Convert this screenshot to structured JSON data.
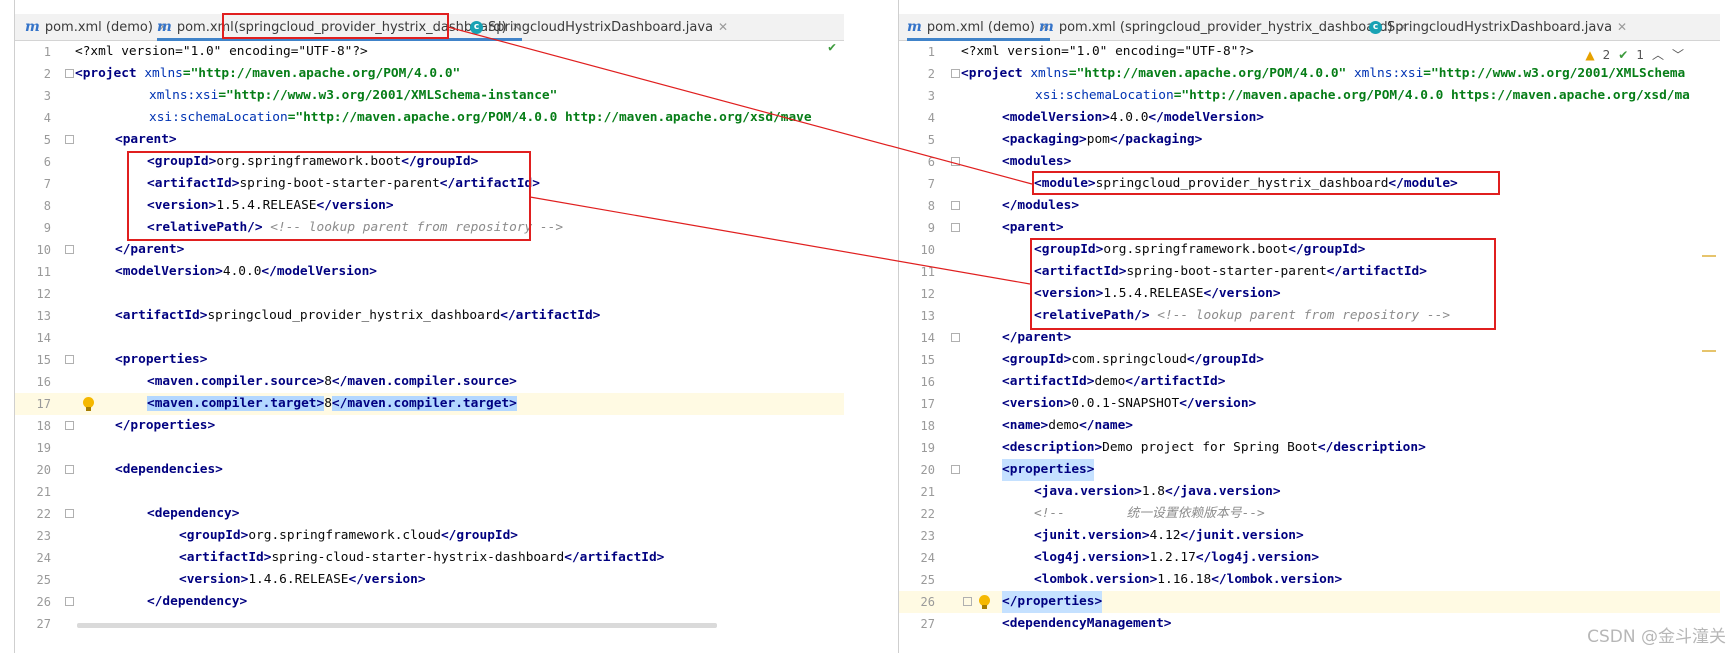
{
  "left_editor": {
    "tabs": [
      {
        "label": "pom.xml (demo)",
        "icon": "maven-icon"
      },
      {
        "label_prefix": "pom.xml ",
        "label_highlight": "(springcloud_provider_hystrix_dashboard)",
        "icon": "maven-icon"
      },
      {
        "label": "SpringcloudHystrixDashboard.java",
        "icon": "java-class-icon"
      }
    ],
    "line_numbers": [
      "1",
      "2",
      "3",
      "4",
      "5",
      "6",
      "7",
      "8",
      "9",
      "10",
      "11",
      "12",
      "13",
      "14",
      "15",
      "16",
      "17",
      "18",
      "19",
      "20",
      "21",
      "22",
      "23",
      "24",
      "25",
      "26",
      "27"
    ],
    "lines": {
      "l1": "<?xml version=\"1.0\" encoding=\"UTF-8\"?>",
      "l2_tag": "<project ",
      "l2_attr": "xmlns",
      "l2_val": "=\"http://maven.apache.org/POM/4.0.0\"",
      "l3_attr": "xmlns:xsi",
      "l3_val": "=\"http://www.w3.org/2001/XMLSchema-instance\"",
      "l4_attr": "xsi:schemaLocation",
      "l4_val": "=\"http://maven.apache.org/POM/4.0.0 http://maven.apache.org/xsd/mave",
      "l5": "<parent>",
      "l6_open": "<groupId>",
      "l6_text": "org.springframework.boot",
      "l6_close": "</groupId>",
      "l7_open": "<artifactId>",
      "l7_text": "spring-boot-starter-parent",
      "l7_close": "</artifactId>",
      "l8_open": "<version>",
      "l8_text": "1.5.4.RELEASE",
      "l8_close": "</version>",
      "l9_open": "<relativePath/>",
      "l9_comment": " <!-- lookup parent from repository -->",
      "l10": "</parent>",
      "l11_open": "<modelVersion>",
      "l11_text": "4.0.0",
      "l11_close": "</modelVersion>",
      "l13_open": "<artifactId>",
      "l13_text": "springcloud_provider_hystrix_dashboard",
      "l13_close": "</artifactId>",
      "l15": "<properties>",
      "l16_open": "<maven.compiler.source>",
      "l16_text": "8",
      "l16_close": "</maven.compiler.source>",
      "l17_open": "<maven.compiler.target>",
      "l17_text": "8",
      "l17_close": "</maven.compiler.target>",
      "l18": "</properties>",
      "l20": "<dependencies>",
      "l22": "<dependency>",
      "l23_open": "<groupId>",
      "l23_text": "org.springframework.cloud",
      "l23_close": "</groupId>",
      "l24_open": "<artifactId>",
      "l24_text": "spring-cloud-starter-hystrix-dashboard",
      "l24_close": "</artifactId>",
      "l25_open": "<version>",
      "l25_text": "1.4.6.RELEASE",
      "l25_close": "</version>",
      "l26": "</dependency>"
    }
  },
  "right_editor": {
    "tabs": [
      {
        "label": "pom.xml (demo)",
        "icon": "maven-icon"
      },
      {
        "label": "pom.xml (springcloud_provider_hystrix_dashboard)",
        "icon": "maven-icon"
      },
      {
        "label": "SpringcloudHystrixDashboard.java",
        "icon": "java-class-icon"
      }
    ],
    "inspection": {
      "warnings": "2",
      "weak_warnings": "1"
    },
    "line_numbers": [
      "1",
      "2",
      "3",
      "4",
      "5",
      "6",
      "7",
      "8",
      "9",
      "10",
      "11",
      "12",
      "13",
      "14",
      "15",
      "16",
      "17",
      "18",
      "19",
      "20",
      "21",
      "22",
      "23",
      "24",
      "25",
      "26",
      "27"
    ],
    "lines": {
      "l1": "<?xml version=\"1.0\" encoding=\"UTF-8\"?>",
      "l2_tag": "<project ",
      "l2_attr": "xmlns",
      "l2_val": "=\"http://maven.apache.org/POM/4.0.0\" ",
      "l2_attr2": "xmlns:xsi",
      "l2_val2": "=\"http://www.w3.org/2001/XMLSchema",
      "l3_attr": "xsi:schemaLocation",
      "l3_val": "=\"http://maven.apache.org/POM/4.0.0 https://maven.apache.org/xsd/ma",
      "l4_open": "<modelVersion>",
      "l4_text": "4.0.0",
      "l4_close": "</modelVersion>",
      "l5_open": "<packaging>",
      "l5_text": "pom",
      "l5_close": "</packaging>",
      "l6": "<modules>",
      "l7_open": "<module>",
      "l7_text": "springcloud_provider_hystrix_dashboard",
      "l7_close": "</module>",
      "l8": "</modules>",
      "l9": "<parent>",
      "l10_open": "<groupId>",
      "l10_text": "org.springframework.boot",
      "l10_close": "</groupId>",
      "l11_open": "<artifactId>",
      "l11_text": "spring-boot-starter-parent",
      "l11_close": "</artifactId>",
      "l12_open": "<version>",
      "l12_text": "1.5.4.RELEASE",
      "l12_close": "</version>",
      "l13_open": "<relativePath/>",
      "l13_comment": " <!-- lookup parent from repository -->",
      "l14": "</parent>",
      "l15_open": "<groupId>",
      "l15_text": "com.springcloud",
      "l15_close": "</groupId>",
      "l16_open": "<artifactId>",
      "l16_text": "demo",
      "l16_close": "</artifactId>",
      "l17_open": "<version>",
      "l17_text": "0.0.1-SNAPSHOT",
      "l17_close": "</version>",
      "l18_open": "<name>",
      "l18_text": "demo",
      "l18_close": "</name>",
      "l19_open": "<description>",
      "l19_text": "Demo project for Spring Boot",
      "l19_close": "</description>",
      "l20": "<properties>",
      "l21_open": "<java.version>",
      "l21_text": "1.8",
      "l21_close": "</java.version>",
      "l22_comment": "<!--        统一设置依赖版本号-->",
      "l23_open": "<junit.version>",
      "l23_text": "4.12",
      "l23_close": "</junit.version>",
      "l24_open": "<log4j.version>",
      "l24_text": "1.2.17",
      "l24_close": "</log4j.version>",
      "l25_open": "<lombok.version>",
      "l25_text": "1.16.18",
      "l25_close": "</lombok.version>",
      "l26": "</properties>",
      "l27": "<dependencyManagement>"
    }
  },
  "watermark": "CSDN @金斗潼关",
  "colors": {
    "annotation": "#e01f1f",
    "tag": "#000080",
    "attr_value": "#067d17",
    "comment": "#8c8c8c"
  }
}
